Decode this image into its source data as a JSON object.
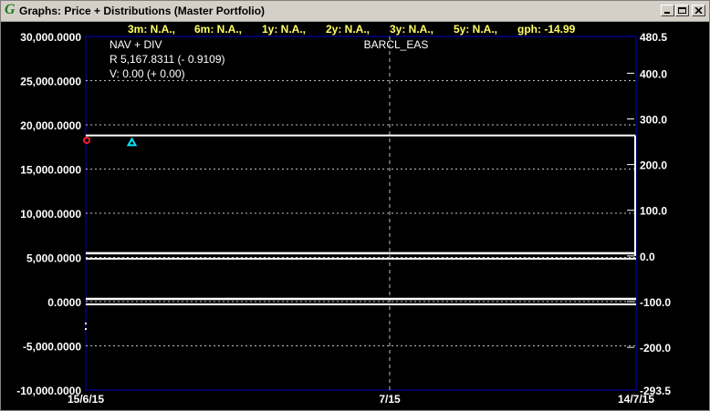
{
  "window": {
    "title": "Graphs: Price + Distributions (Master Portfolio)",
    "icon": "g-app-icon",
    "buttons": [
      "minimize",
      "maximize",
      "close"
    ]
  },
  "stats": [
    {
      "label": "3m:",
      "value": "N.A.,"
    },
    {
      "label": "6m:",
      "value": "N.A.,"
    },
    {
      "label": "1y:",
      "value": "N.A.,"
    },
    {
      "label": "2y:",
      "value": "N.A.,"
    },
    {
      "label": "3y:",
      "value": "N.A.,"
    },
    {
      "label": "5y:",
      "value": "N.A.,"
    },
    {
      "label": "gph:",
      "value": "-14.99"
    }
  ],
  "legend": {
    "line1": "NAV + DIV",
    "line2": "R 5,167.8311 (- 0.9109)",
    "line3": "V: 0.00 (+ 0.00)"
  },
  "chart_data": {
    "type": "line",
    "title": "BARCL_EAS",
    "x_ticks": [
      "15/6/15",
      "7/15",
      "14/7/15"
    ],
    "y_left": {
      "ticks": [
        "30,000.0000",
        "25,000.0000",
        "20,000.0000",
        "15,000.0000",
        "10,000.0000",
        "5,000.0000",
        "0.0000",
        "-5,000.0000",
        "-10,000.0000"
      ],
      "tick_values": [
        30000,
        25000,
        20000,
        15000,
        10000,
        5000,
        0,
        -5000,
        -10000
      ],
      "range": [
        -10000,
        30000
      ]
    },
    "y_right": {
      "ticks": [
        "480.5",
        "400.0",
        "300.0",
        "200.0",
        "100.0",
        "0.0",
        "-100.0",
        "-200.0",
        "-293.5"
      ],
      "tick_values": [
        480.5,
        400,
        300,
        200,
        100,
        0,
        -100,
        -200,
        -293.5
      ],
      "range": [
        -293.5,
        480.5
      ]
    },
    "series": [
      {
        "name": "NAV + DIV",
        "axis": "left",
        "color": "#ffffff",
        "y": 18800
      },
      {
        "name": "R",
        "axis": "left",
        "color": "#ffffff",
        "y": 5167.8311
      },
      {
        "name": "V",
        "axis": "left",
        "color": "#ffffff",
        "y": 0
      }
    ],
    "markers": [
      {
        "type": "triangle",
        "color": "#00e5ff",
        "x_frac": 0.185,
        "y": 18000
      },
      {
        "type": "circle",
        "color": "#ff2020",
        "x_frac": 0.0,
        "y": 18250
      }
    ],
    "grid": true,
    "colors": {
      "background": "#000000",
      "frame": "#0000cc",
      "grid": "#ffffff",
      "stats": "#ffff66"
    }
  }
}
